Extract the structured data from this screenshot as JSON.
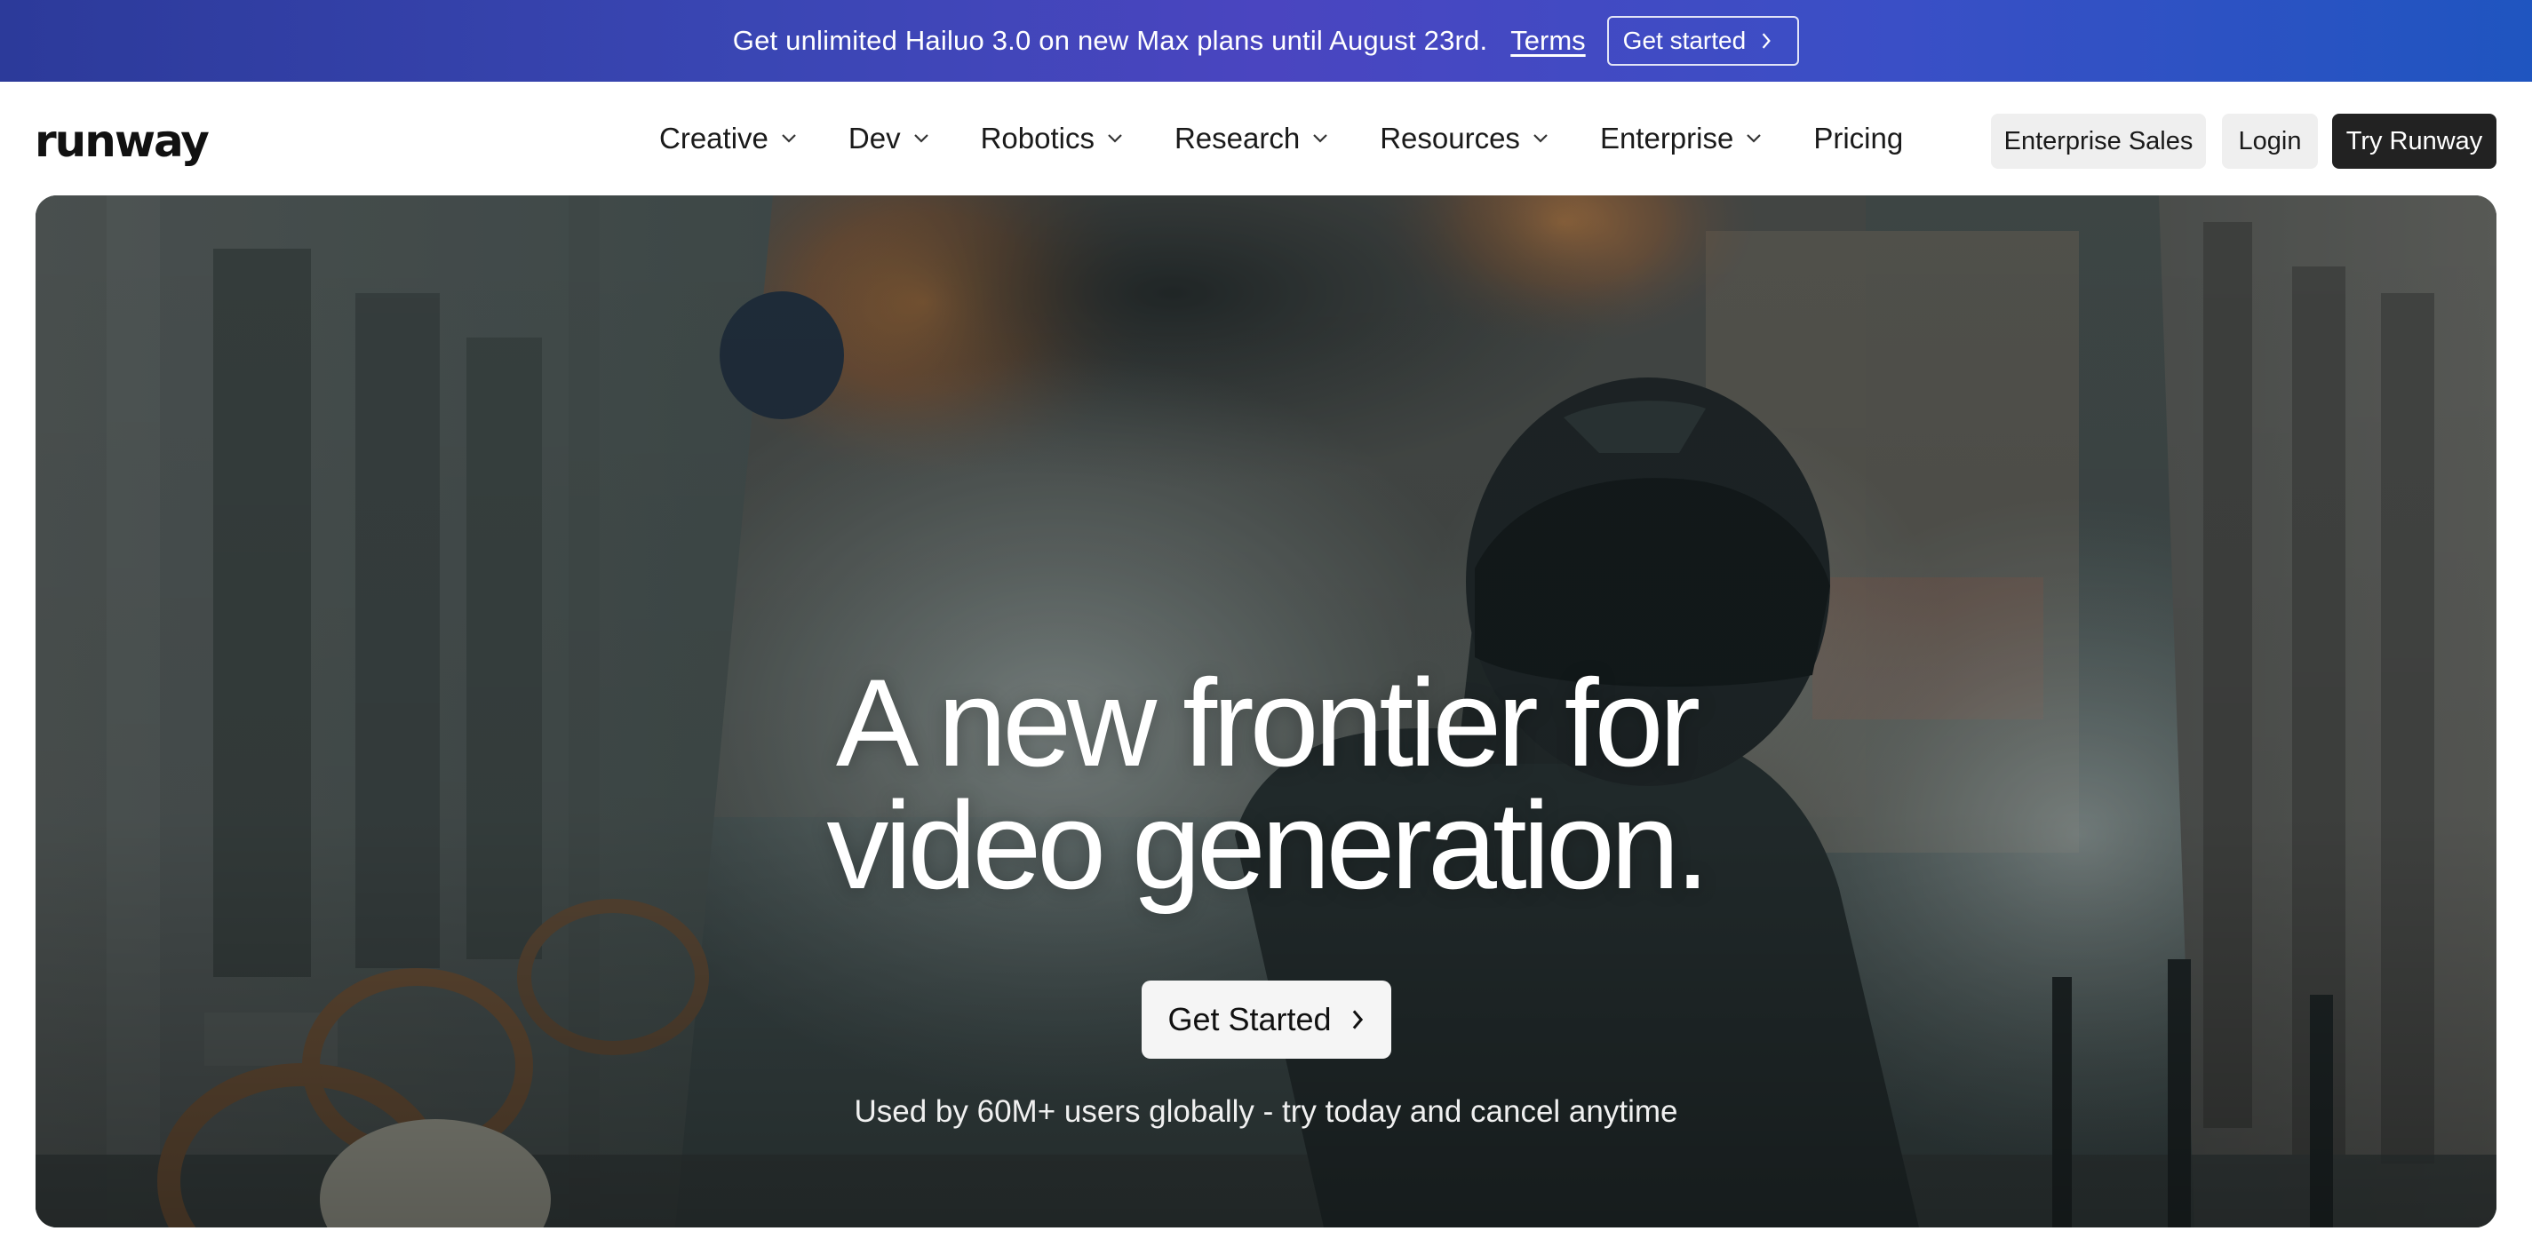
{
  "promo": {
    "text": "Get unlimited Hailuo 3.0 on new Max plans until August 23rd.",
    "terms_label": "Terms",
    "cta_label": "Get started",
    "cta_icon": "chevron-right-icon"
  },
  "nav": {
    "logo": "runway",
    "menu": [
      {
        "label": "Creative",
        "has_dropdown": true
      },
      {
        "label": "Dev",
        "has_dropdown": true
      },
      {
        "label": "Robotics",
        "has_dropdown": true
      },
      {
        "label": "Research",
        "has_dropdown": true
      },
      {
        "label": "Resources",
        "has_dropdown": true
      },
      {
        "label": "Enterprise",
        "has_dropdown": true
      },
      {
        "label": "Pricing",
        "has_dropdown": false
      }
    ],
    "enterprise_sales_label": "Enterprise Sales",
    "login_label": "Login",
    "try_label": "Try Runway"
  },
  "hero": {
    "title_line1": "A new frontier for",
    "title_line2": "video generation.",
    "cta_label": "Get Started",
    "cta_icon": "chevron-right-icon",
    "subtitle": "Used by 60M+ users globally - try today and cancel anytime"
  },
  "colors": {
    "banner_start": "#2c3a9a",
    "banner_end": "#1f55c0",
    "try_button": "#222222",
    "secondary_button": "#efefef"
  }
}
